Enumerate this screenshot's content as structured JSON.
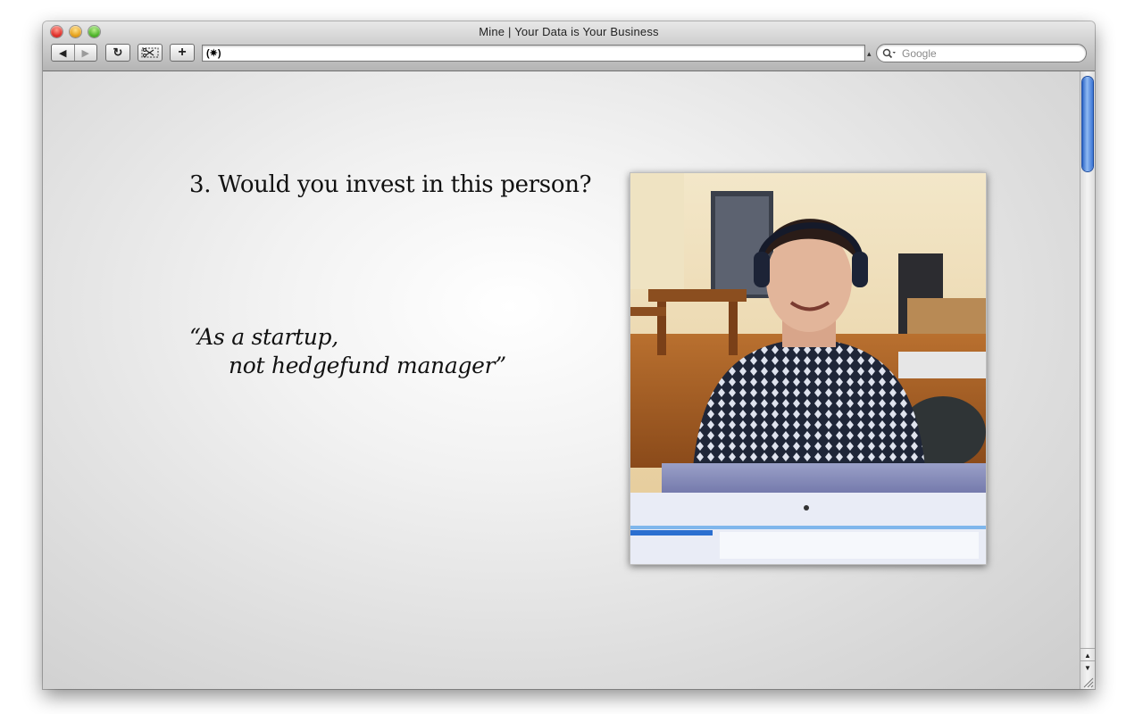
{
  "window": {
    "title": "Mine | Your Data is Your Business"
  },
  "toolbar": {
    "back_glyph": "◀",
    "forward_glyph": "▶",
    "reload_glyph": "↻",
    "plus_glyph": "+",
    "address_text": "(✷)",
    "search_placeholder": "Google"
  },
  "slide": {
    "title": "3. Would you invest in this person?",
    "quote_line1": "“As a startup,",
    "quote_line2": "not hedgefund manager”"
  },
  "icons": [
    "close-icon",
    "minimize-icon",
    "zoom-icon",
    "back-icon",
    "forward-icon",
    "reload-icon",
    "snip-icon",
    "add-icon",
    "search-icon",
    "scroll-up-icon",
    "scroll-down-icon",
    "resize-grip-icon"
  ],
  "colors": {
    "scroll_thumb": "#3a74d4",
    "content_bg": "#dedede"
  }
}
